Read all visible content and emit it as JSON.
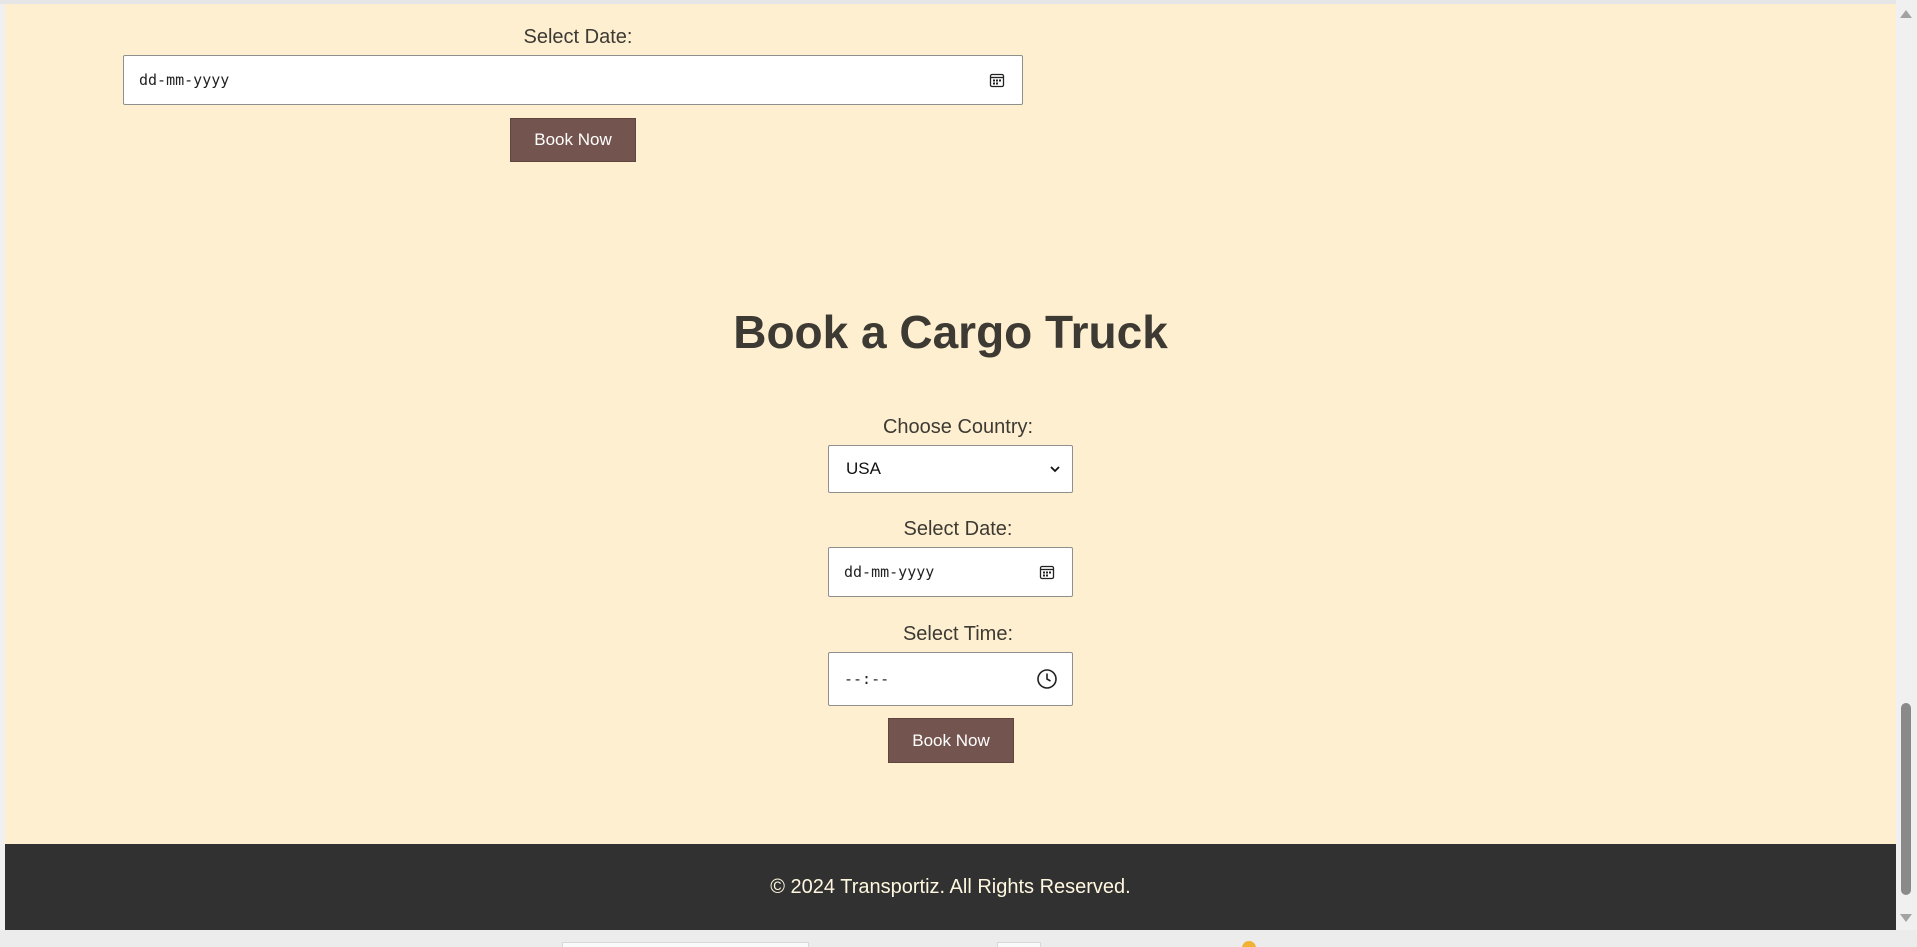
{
  "booking_top": {
    "date_label": "Select Date:",
    "date_placeholder": "dd-mm-yyyy",
    "button_label": "Book Now"
  },
  "cargo": {
    "heading": "Book a Cargo Truck",
    "country_label": "Choose Country:",
    "country_selected": "USA",
    "date_label": "Select Date:",
    "date_placeholder": "dd-mm-yyyy",
    "time_label": "Select Time:",
    "time_placeholder": "--:--",
    "button_label": "Book Now"
  },
  "footer": {
    "text": "© 2024 Transportiz. All Rights Reserved."
  },
  "colors": {
    "page_bg": "#feefd1",
    "button_bg": "#74544e",
    "footer_bg": "#313131"
  }
}
